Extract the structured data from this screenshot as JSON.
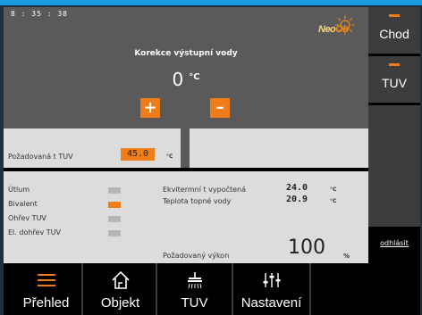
{
  "status": {
    "clock": "8 : 35 : 38"
  },
  "brand": {
    "logo_part1": "Neo",
    "logo_part2": "Ob"
  },
  "control": {
    "title": "Korekce výstupní vody",
    "value": "0",
    "unit": "°C",
    "plus_label": "+",
    "minus_label": "–"
  },
  "requested": {
    "label": "Požadovaná t TUV",
    "value": "45.0",
    "unit": "°C"
  },
  "indicators": [
    {
      "label": "Útlum",
      "on": false
    },
    {
      "label": "Bivalent",
      "on": true
    },
    {
      "label": "Ohřev TUV",
      "on": false
    },
    {
      "label": "El. dohřev TUV",
      "on": false
    }
  ],
  "readings": [
    {
      "label": "Ekvitermní t vypočtená",
      "value": "24.0",
      "unit": "°C"
    },
    {
      "label": "Teplota topné vody",
      "value": "20.9",
      "unit": "°C"
    }
  ],
  "power": {
    "label": "Požadovaný výkon",
    "value": "100",
    "unit": "%"
  },
  "side": {
    "chod": "Chod",
    "tuv": "TUV",
    "logout": "odhlásit"
  },
  "nav": {
    "prehled": "Přehled",
    "objekt": "Objekt",
    "tuv": "TUV",
    "nastaveni": "Nastavení"
  },
  "colors": {
    "accent": "#f07d1a",
    "panel": "#5a5a5a",
    "light_panel": "#dcdcdc",
    "top_bar": "#1a9be0"
  }
}
